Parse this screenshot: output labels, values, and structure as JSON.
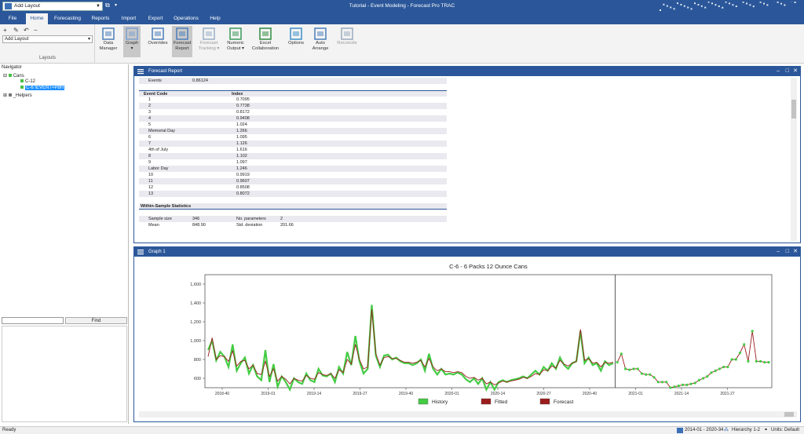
{
  "titlebar": {
    "layout_combo": "Add Layout",
    "title": "Tutorial - Event Modeling - Forecast Pro TRAC"
  },
  "tabs": [
    "File",
    "Home",
    "Forecasting",
    "Reports",
    "Import",
    "Export",
    "Operations",
    "Help"
  ],
  "ribbon": {
    "layout_select": "Add Layout",
    "layouts_label": "Layouts",
    "buttons": [
      {
        "label1": "Data",
        "label2": "Manager",
        "icon": "data-manager-icon"
      },
      {
        "label1": "Graph",
        "label2": "▾",
        "icon": "graph-icon",
        "selected": true
      },
      {
        "label1": "Overrides",
        "label2": "",
        "icon": "overrides-icon"
      },
      {
        "label1": "Forecast",
        "label2": "Report",
        "icon": "forecast-report-icon",
        "selected": true
      },
      {
        "label1": "Forecast",
        "label2": "Tracking ▾",
        "icon": "forecast-tracking-icon",
        "disabled": true
      },
      {
        "label1": "Numeric",
        "label2": "Output ▾",
        "icon": "numeric-output-icon"
      },
      {
        "label1": "Excel",
        "label2": "Collaboration",
        "icon": "excel-icon"
      },
      {
        "label1": "Options",
        "label2": "",
        "icon": "options-gear-icon"
      },
      {
        "label1": "Auto",
        "label2": "Arrange",
        "icon": "auto-arrange-icon"
      },
      {
        "label1": "Reconcile",
        "label2": "",
        "icon": "reconcile-icon",
        "disabled": true
      }
    ]
  },
  "navigator": {
    "title": "Navigator",
    "tree": [
      {
        "label": "Cans",
        "expander": "⊟"
      },
      {
        "label": "C-12"
      },
      {
        "label": "C-6  \\EVENT=P8H"
      },
      {
        "label": "_Helpers",
        "expander": "⊞"
      }
    ],
    "find_label": "Find"
  },
  "report": {
    "title": "Forecast Report",
    "events_label": "Events",
    "events_value": "0.86124",
    "table_head": [
      "Event Code",
      "Index"
    ],
    "rows": [
      [
        "1",
        "0.7095"
      ],
      [
        "2",
        "0.7738"
      ],
      [
        "3",
        "0.8172"
      ],
      [
        "4",
        "0.9408"
      ],
      [
        "5",
        "1.024"
      ],
      [
        "Memorial Day",
        "1.266"
      ],
      [
        "6",
        "1.095"
      ],
      [
        "7",
        "1.126"
      ],
      [
        "4th of July",
        "1.616"
      ],
      [
        "8",
        "1.102"
      ],
      [
        "9",
        "1.097"
      ],
      [
        "Labor Day",
        "1.246"
      ],
      [
        "10",
        "0.9919"
      ],
      [
        "11",
        "0.9607"
      ],
      [
        "12",
        "0.8508"
      ],
      [
        "13",
        "0.8072"
      ]
    ],
    "section": "Within-Sample Statistics",
    "stats": [
      [
        "Sample size",
        "346",
        "No. parameters",
        "2"
      ],
      [
        "Mean",
        "848.90",
        "Std. deviation",
        "201.66"
      ]
    ]
  },
  "graph": {
    "title": "Graph 1"
  },
  "colors": {
    "history": "#44cc44",
    "fitted": "#9b1c1c",
    "forecast": "#9b1c1c",
    "accent": "#2b579a"
  },
  "chart_data": {
    "type": "line",
    "title": "C-6 - 6 Packs 12 Ounce Cans",
    "yticks": [
      "1,600",
      "1,400",
      "1,200",
      "1,000",
      "800",
      "600"
    ],
    "ylim": [
      500,
      1700
    ],
    "xticks": [
      "2018-40",
      "2019-01",
      "2019-14",
      "2019-27",
      "2019-40",
      "2020-01",
      "2020-14",
      "2020-27",
      "2020-40",
      "2021-01",
      "2021-14",
      "2021-27"
    ],
    "series": [
      {
        "name": "History",
        "values": [
          900,
          1000,
          790,
          880,
          830,
          720,
          960,
          680,
          760,
          820,
          650,
          740,
          620,
          580,
          900,
          560,
          750,
          510,
          620,
          560,
          480,
          600,
          560,
          540,
          650,
          580,
          560,
          700,
          630,
          620,
          650,
          560,
          720,
          650,
          880,
          740,
          1050,
          780,
          650,
          700,
          1380,
          840,
          720,
          840,
          850,
          800,
          820,
          780,
          760,
          760,
          740,
          760,
          800,
          680,
          860,
          700,
          640,
          700,
          640,
          650,
          640,
          660,
          640,
          590,
          560,
          600,
          540,
          600,
          480,
          560,
          480,
          560,
          580,
          560,
          580,
          590,
          600,
          620,
          600,
          640,
          680,
          640,
          720,
          680,
          760,
          700,
          820,
          740,
          700,
          760,
          780,
          1100,
          760,
          820,
          740,
          760,
          680,
          780,
          740,
          760
        ]
      },
      {
        "name": "Fitted",
        "values": [
          830,
          1030,
          800,
          840,
          830,
          780,
          890,
          730,
          780,
          790,
          700,
          740,
          650,
          640,
          780,
          620,
          700,
          570,
          620,
          590,
          540,
          600,
          580,
          570,
          630,
          600,
          590,
          660,
          640,
          630,
          650,
          600,
          690,
          660,
          800,
          750,
          960,
          800,
          700,
          720,
          1330,
          860,
          740,
          820,
          830,
          810,
          810,
          790,
          770,
          770,
          760,
          770,
          790,
          720,
          810,
          720,
          680,
          700,
          670,
          670,
          660,
          670,
          660,
          620,
          600,
          610,
          580,
          600,
          540,
          560,
          530,
          550,
          570,
          560,
          570,
          580,
          590,
          610,
          600,
          620,
          650,
          640,
          690,
          680,
          730,
          710,
          790,
          750,
          730,
          760,
          780,
          1120,
          790,
          810,
          760,
          770,
          720,
          770,
          760,
          770
        ]
      },
      {
        "name": "Forecast",
        "values": [
          770,
          860,
          700,
          690,
          700,
          700,
          650,
          640,
          640,
          610,
          560,
          560,
          560,
          500,
          510,
          520,
          530,
          530,
          540,
          550,
          580,
          600,
          620,
          660,
          680,
          700,
          720,
          720,
          800,
          800,
          870,
          960,
          780,
          1100,
          780,
          780,
          770,
          770
        ]
      }
    ],
    "legend": [
      "History",
      "Fitted",
      "Forecast"
    ],
    "legend_position": "bottom"
  },
  "status": {
    "left": "Ready",
    "period": "2014-01 - 2020-34",
    "hierarchy": "Hierarchy 1-2",
    "units": "Units: Default"
  }
}
